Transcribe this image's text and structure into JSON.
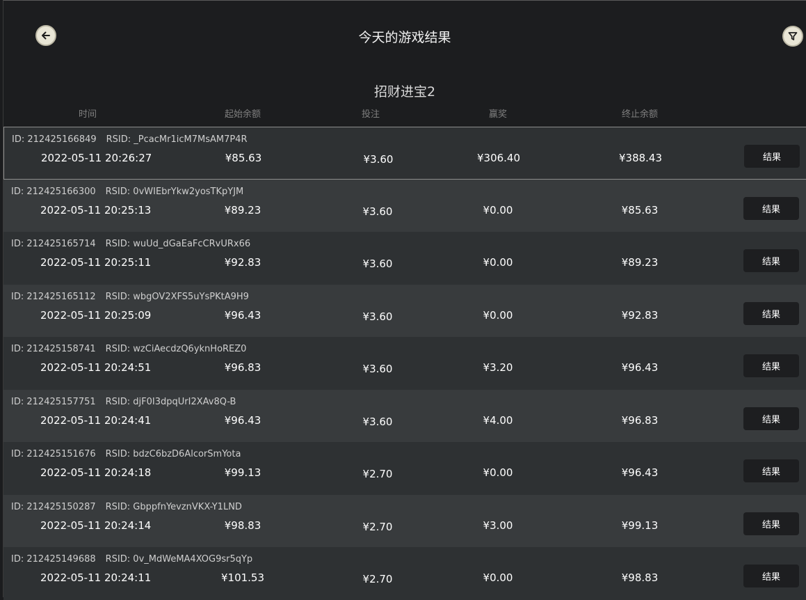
{
  "header": {
    "title": "今天的游戏结果",
    "back_icon": "arrow-left-icon",
    "filter_icon": "filter-icon"
  },
  "game": {
    "name": "招财进宝2"
  },
  "columns": {
    "time": "时间",
    "start_balance": "起始余额",
    "bet": "投注",
    "win": "赢奖",
    "end_balance": "终止余额"
  },
  "labels": {
    "id": "ID:",
    "rsid": "RSID:"
  },
  "rows": [
    {
      "id": "212425166849",
      "rsid": "_PcacMr1icM7MsAM7P4R",
      "time": "2022-05-11 20:26:27",
      "start": "¥85.63",
      "bet": "¥3.60",
      "win": "¥306.40",
      "end": "¥388.43",
      "button": "结果"
    },
    {
      "id": "212425166300",
      "rsid": "0vWIEbrYkw2yosTKpYJM",
      "time": "2022-05-11 20:25:13",
      "start": "¥89.23",
      "bet": "¥3.60",
      "win": "¥0.00",
      "end": "¥85.63",
      "button": "结果"
    },
    {
      "id": "212425165714",
      "rsid": "wuUd_dGaEaFcCRvURx66",
      "time": "2022-05-11 20:25:11",
      "start": "¥92.83",
      "bet": "¥3.60",
      "win": "¥0.00",
      "end": "¥89.23",
      "button": "结果"
    },
    {
      "id": "212425165112",
      "rsid": "wbgOV2XFS5uYsPKtA9H9",
      "time": "2022-05-11 20:25:09",
      "start": "¥96.43",
      "bet": "¥3.60",
      "win": "¥0.00",
      "end": "¥92.83",
      "button": "结果"
    },
    {
      "id": "212425158741",
      "rsid": "wzCiAecdzQ6yknHoREZ0",
      "time": "2022-05-11 20:24:51",
      "start": "¥96.83",
      "bet": "¥3.60",
      "win": "¥3.20",
      "end": "¥96.43",
      "button": "结果"
    },
    {
      "id": "212425157751",
      "rsid": "djF0I3dpqUrI2XAv8Q-B",
      "time": "2022-05-11 20:24:41",
      "start": "¥96.43",
      "bet": "¥3.60",
      "win": "¥4.00",
      "end": "¥96.83",
      "button": "结果"
    },
    {
      "id": "212425151676",
      "rsid": "bdzC6bzD6AlcorSmYota",
      "time": "2022-05-11 20:24:18",
      "start": "¥99.13",
      "bet": "¥2.70",
      "win": "¥0.00",
      "end": "¥96.43",
      "button": "结果"
    },
    {
      "id": "212425150287",
      "rsid": "GbppfnYevznVKX-Y1LND",
      "time": "2022-05-11 20:24:14",
      "start": "¥98.83",
      "bet": "¥2.70",
      "win": "¥3.00",
      "end": "¥99.13",
      "button": "结果"
    },
    {
      "id": "212425149688",
      "rsid": "0v_MdWeMA4XOG9sr5qYp",
      "time": "2022-05-11 20:24:11",
      "start": "¥101.53",
      "bet": "¥2.70",
      "win": "¥0.00",
      "end": "¥98.83",
      "button": "结果"
    }
  ]
}
